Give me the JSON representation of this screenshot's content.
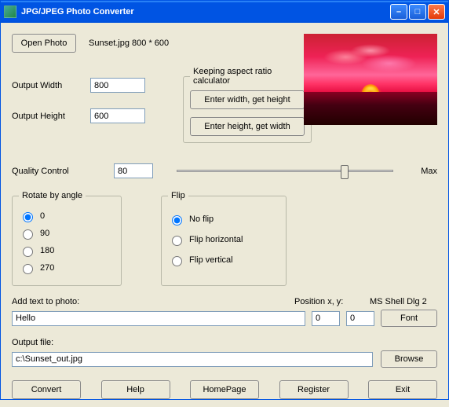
{
  "title": "JPG/JPEG Photo Converter",
  "openPhoto": "Open Photo",
  "photoInfo": "Sunset.jpg 800 * 600",
  "labels": {
    "outputWidth": "Output Width",
    "outputHeight": "Output Height",
    "qualityControl": "Quality Control",
    "max": "Max",
    "addText": "Add text to photo:",
    "position": "Position x, y:",
    "fontName": "MS Shell Dlg 2",
    "outputFile": "Output file:"
  },
  "values": {
    "width": "800",
    "height": "600",
    "quality": "80",
    "text": "Hello",
    "posX": "0",
    "posY": "0",
    "outputPath": "c:\\Sunset_out.jpg"
  },
  "aspect": {
    "legend": "Keeping aspect ratio calculator",
    "widthBtn": "Enter width, get height",
    "heightBtn": "Enter height, get width"
  },
  "rotate": {
    "legend": "Rotate by angle",
    "opts": [
      "0",
      "90",
      "180",
      "270"
    ],
    "selected": "0"
  },
  "flip": {
    "legend": "Flip",
    "opts": [
      "No flip",
      "Flip horizontal",
      "Flip vertical"
    ],
    "selected": "No flip"
  },
  "buttons": {
    "font": "Font",
    "browse": "Browse",
    "convert": "Convert",
    "help": "Help",
    "homepage": "HomePage",
    "register": "Register",
    "exit": "Exit"
  }
}
